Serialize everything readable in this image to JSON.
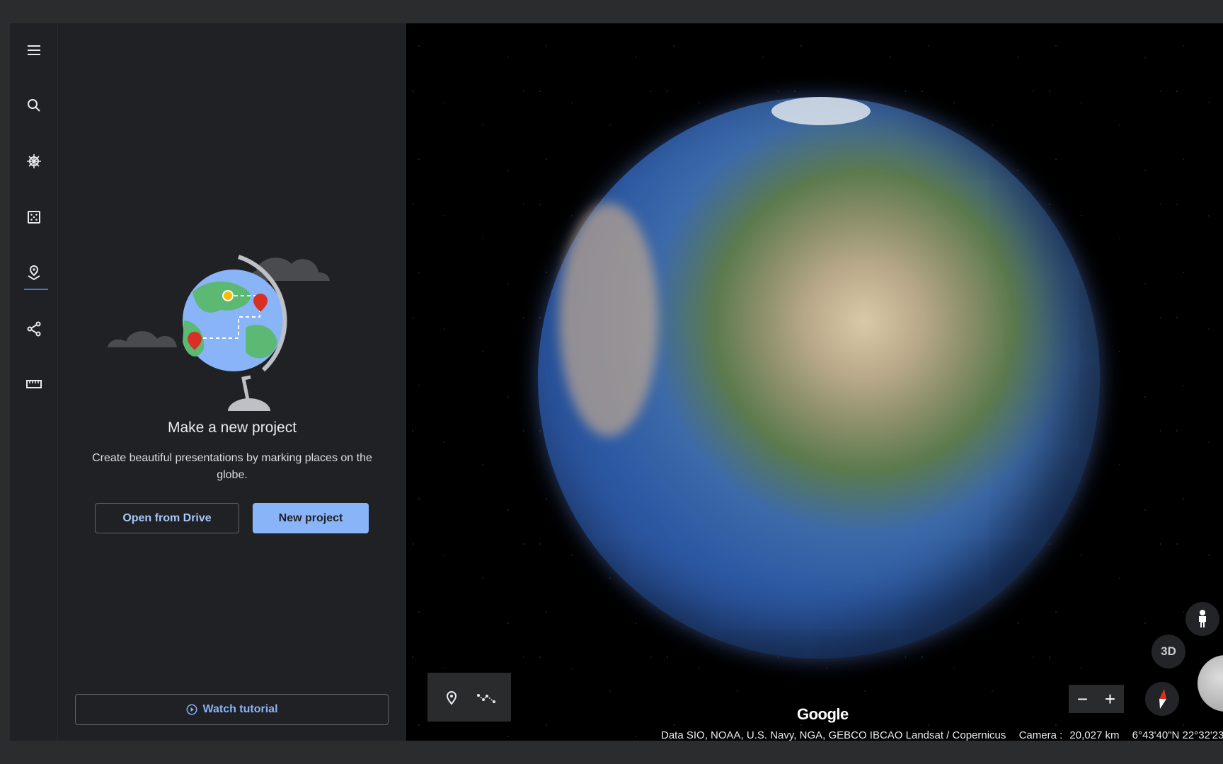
{
  "rail": {
    "items": [
      {
        "name": "menu",
        "icon": "hamburger-icon"
      },
      {
        "name": "search",
        "icon": "search-icon"
      },
      {
        "name": "voyager",
        "icon": "ship-wheel-icon"
      },
      {
        "name": "feeling-lucky",
        "icon": "dice-icon"
      },
      {
        "name": "projects",
        "icon": "map-pin-icon",
        "active": true
      },
      {
        "name": "share",
        "icon": "share-icon"
      },
      {
        "name": "measure",
        "icon": "ruler-icon"
      }
    ]
  },
  "panel": {
    "title": "Make a new project",
    "description": "Create beautiful presentations by marking places on the globe.",
    "open_drive": "Open from Drive",
    "new_project": "New project",
    "watch_tutorial": "Watch tutorial"
  },
  "map": {
    "logo": "Google",
    "attribution": "Data SIO, NOAA, U.S. Navy, NGA, GEBCO IBCAO Landsat / Copernicus",
    "camera_label": "Camera :",
    "camera_distance": "20,027 km",
    "coordinates": "6°43'40\"N 22°32'23",
    "zoom_out": "−",
    "zoom_in": "+",
    "view_mode": "3D"
  },
  "colors": {
    "accent": "#8ab4f8",
    "active_indicator": "#4a72d6",
    "background": "#202124"
  }
}
